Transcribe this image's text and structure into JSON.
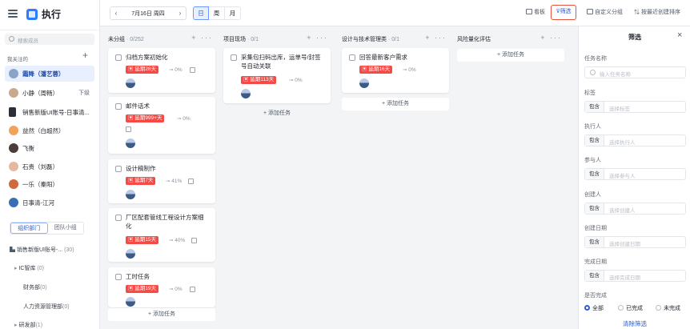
{
  "app": {
    "title": "执行"
  },
  "sidebar": {
    "search_placeholder": "搜索成员",
    "section_title": "我关注的",
    "section_add": "+",
    "people": [
      {
        "name": "霜降（潘艺蓉）",
        "tag": "",
        "color": "#8aa4c8"
      },
      {
        "name": "小静（周畅）",
        "tag": "下级",
        "color": "#c9a98b"
      },
      {
        "name": "销售新版UI账号-日事清...",
        "tag": "",
        "color": "#2a2f38"
      },
      {
        "name": "益然（白超然）",
        "tag": "",
        "color": "#f0a35a"
      },
      {
        "name": "飞衡",
        "tag": "",
        "color": "#4a3f38"
      },
      {
        "name": "石贵（刘磊）",
        "tag": "",
        "color": "#e6b8a2"
      },
      {
        "name": "一乐（秦阳）",
        "tag": "",
        "color": "#d2683d"
      },
      {
        "name": "日事清-江河",
        "tag": "",
        "color": "#3a6fb5"
      }
    ],
    "tabs": [
      "组织部门",
      "团队小组"
    ],
    "org": [
      {
        "label": "销售新版UI账号-...",
        "count": "(30)"
      },
      {
        "label": "IC智库",
        "count": "(0)"
      },
      {
        "label": "财务部",
        "count": "(0)"
      },
      {
        "label": "人力资源管理部",
        "count": "(0)"
      },
      {
        "label": "研发部",
        "count": "(1)"
      }
    ]
  },
  "toolbar": {
    "date": "7月16日 周四",
    "prev": "‹",
    "next": "›",
    "views": [
      "日",
      "周",
      "月"
    ],
    "actions": {
      "board": "看板",
      "filter": "筛选",
      "custom_group": "自定义分组",
      "sort": "按最近创建排序"
    }
  },
  "columns": [
    {
      "name": "未分组",
      "count": "· 0/252",
      "cards": [
        {
          "title": "归档方案初始化",
          "badge": "延期28天",
          "progress": "0%"
        },
        {
          "title": "邮件话术",
          "badge": "延期999+天",
          "progress": "0%"
        },
        {
          "title": "设计稿制作",
          "badge": "延期7天",
          "progress": "41%"
        },
        {
          "title": "厂区配套管线工程设计方案细化",
          "badge": "延期15天",
          "progress": "40%"
        },
        {
          "title": "工时任务",
          "badge": "延期19天",
          "progress": "0%"
        }
      ],
      "add_label": "+ 添加任务"
    },
    {
      "name": "项目现场",
      "count": "· 0/1",
      "cards": [
        {
          "title": "采集包扫码出库，运单号/封签号自动关联",
          "badge": "延期113天",
          "progress": "0%"
        }
      ],
      "add_label": "+ 添加任务"
    },
    {
      "name": "设计与技术管理类",
      "count": "· 0/1",
      "cards": [
        {
          "title": "回答最新客户需求",
          "badge": "延期16天",
          "progress": "0%"
        }
      ],
      "add_label": "+ 添加任务"
    },
    {
      "name": "风险量化评估",
      "count": "",
      "cards": [],
      "add_label": "+ 添加任务"
    }
  ],
  "filter_panel": {
    "title": "筛选",
    "close": "×",
    "task_name_label": "任务名称",
    "task_name_placeholder": "输入任务名称",
    "include": "包含",
    "fields": [
      {
        "label": "标签",
        "placeholder": "选择标签"
      },
      {
        "label": "执行人",
        "placeholder": "选择执行人"
      },
      {
        "label": "参与人",
        "placeholder": "选择参与人"
      },
      {
        "label": "创建人",
        "placeholder": "选择创建人"
      },
      {
        "label": "创建日期",
        "placeholder": "选择创建日期"
      },
      {
        "label": "完成日期",
        "placeholder": "选择完成日期"
      }
    ],
    "done_label": "是否完成",
    "done_options": [
      "全部",
      "已完成",
      "未完成"
    ],
    "done_selected": "全部",
    "clear": "清除筛选"
  },
  "colors": {
    "accent": "#2b5bd7",
    "overdue": "#f54a45",
    "highlight": "#e8533c"
  }
}
